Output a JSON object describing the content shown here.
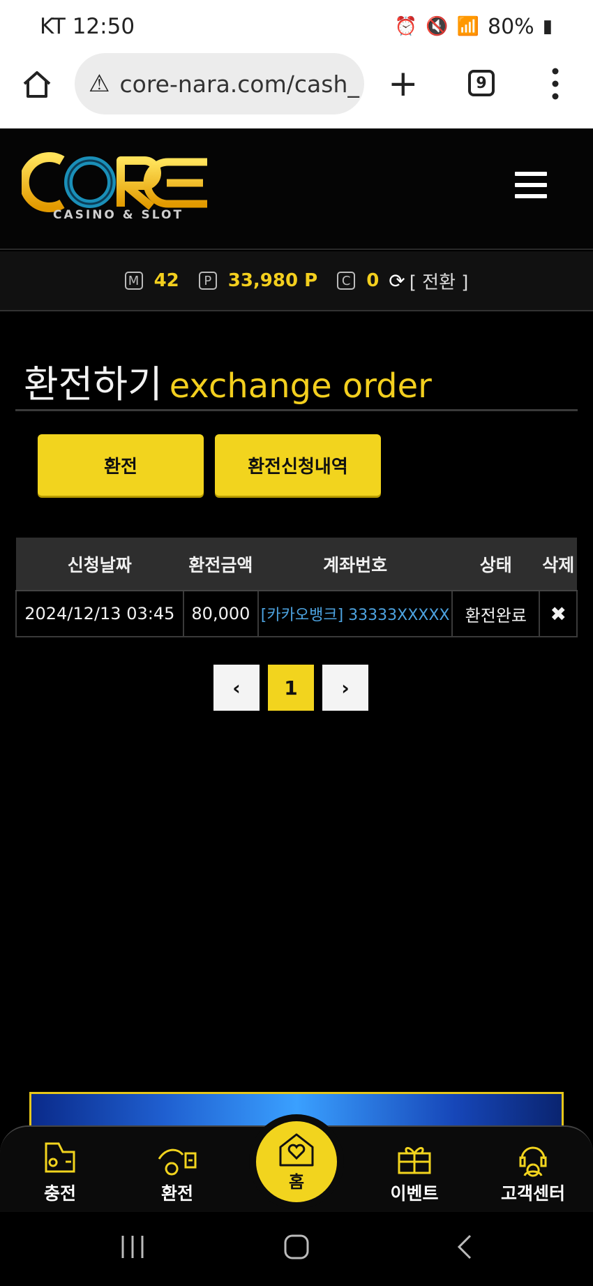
{
  "status_bar": {
    "carrier_time": "KT 12:50",
    "battery": "80%"
  },
  "browser": {
    "url": "core-nara.com/cash_",
    "tab_count": "9"
  },
  "site": {
    "brand": "CORE",
    "brand_sub": "CASINO & SLOT"
  },
  "points": {
    "m_label": "M",
    "m_value": "42",
    "p_label": "P",
    "p_value": "33,980 P",
    "c_label": "C",
    "c_value": "0",
    "switch_label": "[ 전환 ]"
  },
  "page": {
    "title_ko": "환전하기",
    "title_en": "exchange order"
  },
  "actions": {
    "exchange": "환전",
    "history": "환전신청내역"
  },
  "table": {
    "headers": [
      "신청날짜",
      "환전금액",
      "계좌번호",
      "상태",
      "삭제"
    ],
    "rows": [
      {
        "date": "2024/12/13 03:45",
        "amount": "80,000",
        "account": "[카카오뱅크] 33333XXXXX",
        "status": "환전완료",
        "delete": "✖"
      }
    ]
  },
  "pagination": {
    "prev": "‹",
    "current": "1",
    "next": "›"
  },
  "bottom_nav": {
    "charge": "충전",
    "exchange": "환전",
    "home": "홈",
    "event": "이벤트",
    "support": "고객센터"
  },
  "colors": {
    "accent": "#f2d41e",
    "link": "#4da3e0",
    "background": "#000000"
  }
}
